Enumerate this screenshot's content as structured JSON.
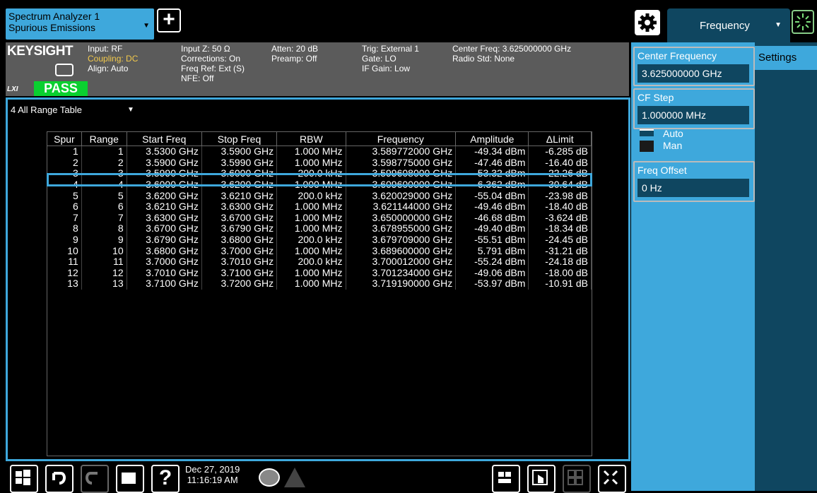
{
  "app_tab": {
    "line1": "Spectrum Analyzer 1",
    "line2": "Spurious Emissions"
  },
  "add_label": "+",
  "menu": {
    "label": "Frequency"
  },
  "settings_tab": "Settings",
  "brand": {
    "name": "KEYSIGHT",
    "status": "PASS",
    "lxi": "LXI"
  },
  "info": {
    "col1": [
      "Input: RF",
      "Coupling: DC",
      "Align: Auto"
    ],
    "col2": [
      "Input Z: 50 Ω",
      "Corrections: On",
      "Freq Ref: Ext (S)",
      "NFE: Off"
    ],
    "col3": [
      "Atten: 20 dB",
      "Preamp: Off"
    ],
    "col4": [
      "Trig: External 1",
      "Gate: LO",
      "IF Gain: Low"
    ],
    "col5": [
      "Center Freq: 3.625000000 GHz",
      "Radio Std: None"
    ]
  },
  "window": {
    "title": "4 All Range Table"
  },
  "table": {
    "headers": [
      "Spur",
      "Range",
      "Start Freq",
      "Stop Freq",
      "RBW",
      "Frequency",
      "Amplitude",
      "ΔLimit"
    ],
    "selected_row": 3,
    "rows": [
      [
        "1",
        "1",
        "3.5300 GHz",
        "3.5900 GHz",
        "1.000 MHz",
        "3.589772000 GHz",
        "-49.34 dBm",
        "-6.285 dB"
      ],
      [
        "2",
        "2",
        "3.5900 GHz",
        "3.5990 GHz",
        "1.000 MHz",
        "3.598775000 GHz",
        "-47.46 dBm",
        "-16.40 dB"
      ],
      [
        "3",
        "3",
        "3.5990 GHz",
        "3.6000 GHz",
        "200.0 kHz",
        "3.599608000 GHz",
        "-53.32 dBm",
        "-22.26 dB"
      ],
      [
        "4",
        "4",
        "3.6000 GHz",
        "3.6200 GHz",
        "1.000 MHz",
        "3.609600000 GHz",
        "6.362 dBm",
        "-30.64 dB"
      ],
      [
        "5",
        "5",
        "3.6200 GHz",
        "3.6210 GHz",
        "200.0 kHz",
        "3.620029000 GHz",
        "-55.04 dBm",
        "-23.98 dB"
      ],
      [
        "6",
        "6",
        "3.6210 GHz",
        "3.6300 GHz",
        "1.000 MHz",
        "3.621144000 GHz",
        "-49.46 dBm",
        "-18.40 dB"
      ],
      [
        "7",
        "7",
        "3.6300 GHz",
        "3.6700 GHz",
        "1.000 MHz",
        "3.650000000 GHz",
        "-46.68 dBm",
        "-3.624 dB"
      ],
      [
        "8",
        "8",
        "3.6700 GHz",
        "3.6790 GHz",
        "1.000 MHz",
        "3.678955000 GHz",
        "-49.40 dBm",
        "-18.34 dB"
      ],
      [
        "9",
        "9",
        "3.6790 GHz",
        "3.6800 GHz",
        "200.0 kHz",
        "3.679709000 GHz",
        "-55.51 dBm",
        "-24.45 dB"
      ],
      [
        "10",
        "10",
        "3.6800 GHz",
        "3.7000 GHz",
        "1.000 MHz",
        "3.689600000 GHz",
        "5.791 dBm",
        "-31.21 dB"
      ],
      [
        "11",
        "11",
        "3.7000 GHz",
        "3.7010 GHz",
        "200.0 kHz",
        "3.700012000 GHz",
        "-55.24 dBm",
        "-24.18 dB"
      ],
      [
        "12",
        "12",
        "3.7010 GHz",
        "3.7100 GHz",
        "1.000 MHz",
        "3.701234000 GHz",
        "-49.06 dBm",
        "-18.00 dB"
      ],
      [
        "13",
        "13",
        "3.7100 GHz",
        "3.7200 GHz",
        "1.000 MHz",
        "3.719190000 GHz",
        "-53.97 dBm",
        "-10.91 dB"
      ]
    ]
  },
  "controls": {
    "center_freq": {
      "label": "Center Frequency",
      "value": "3.625000000 GHz"
    },
    "cf_step": {
      "label": "CF Step",
      "value": "1.000000 MHz",
      "auto": "Auto",
      "man": "Man"
    },
    "freq_offset": {
      "label": "Freq Offset",
      "value": "0 Hz"
    }
  },
  "datetime": {
    "date": "Dec 27, 2019",
    "time": "11:16:19 AM"
  },
  "colors": {
    "accent": "#3ea8dc",
    "dark_panel": "#0f4660",
    "info_bg": "#5b5b5b",
    "pass": "#0ad030",
    "coupling": "#f2c94c"
  }
}
